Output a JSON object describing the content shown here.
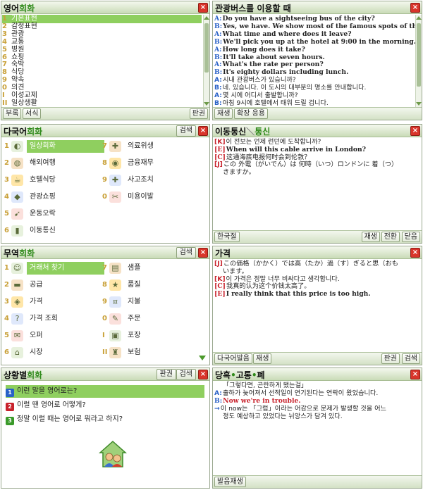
{
  "colors": {
    "accent_green": "#8fcf5f",
    "title_green": "#2f8a1a",
    "number_gold": "#c8a037",
    "speaker_red": "#c8222c",
    "speaker_blue": "#2a62c7"
  },
  "p1": {
    "title_a": "영어",
    "title_b": "회화",
    "items": [
      {
        "num": "1",
        "label": "기본표현"
      },
      {
        "num": "2",
        "label": "감정표현"
      },
      {
        "num": "3",
        "label": "관광"
      },
      {
        "num": "4",
        "label": "교통"
      },
      {
        "num": "5",
        "label": "병원"
      },
      {
        "num": "6",
        "label": "쇼핑"
      },
      {
        "num": "7",
        "label": "숙박"
      },
      {
        "num": "8",
        "label": "식당"
      },
      {
        "num": "9",
        "label": "약속"
      },
      {
        "num": "0",
        "label": "의견"
      },
      {
        "num": "I",
        "label": "이성교제"
      },
      {
        "num": "II",
        "label": "일상생활"
      }
    ],
    "btn_appendix": "부록",
    "btn_format": "서식",
    "btn_switch": "판권"
  },
  "p2": {
    "title": "관광버스를 이용할 때",
    "lines": [
      {
        "p": "A:",
        "t": "Do you have a sightseeing bus of the city?"
      },
      {
        "p": "B:",
        "t": "Yes, we have. We show most of the famous spots of this city."
      },
      {
        "p": "A:",
        "t": "What time and where does it leave?"
      },
      {
        "p": "B:",
        "t": "We'll pick you up at the hotel at 9:00 in the morning."
      },
      {
        "p": "A:",
        "t": "How long does it take?"
      },
      {
        "p": "B:",
        "t": "It'll take about seven hours."
      },
      {
        "p": "A:",
        "t": "What's the rate per person?"
      },
      {
        "p": "B:",
        "t": "It's eighty dollars including lunch."
      },
      {
        "p": "A:",
        "t": "시내 관광버스가 있습니까?"
      },
      {
        "p": "B:",
        "t": "네. 있습니다. 이 도시의 대부분의 명소를 안내합니다."
      },
      {
        "p": "A:",
        "t": "몇 시에 어디서 출발합니까?"
      },
      {
        "p": "B:",
        "t": "아침 9시에 호텔에서 태워 드릴 겁니다."
      }
    ],
    "btn_play": "재생",
    "btn_expand": "확장 응용"
  },
  "p3": {
    "title_a": "다국어",
    "title_b": "회화",
    "btn_search": "검색",
    "items": [
      {
        "num": "1",
        "label": "일상회화",
        "icon": "ear-icon"
      },
      {
        "num": "2",
        "label": "해외여행",
        "icon": "globe-icon"
      },
      {
        "num": "3",
        "label": "호텔식당",
        "icon": "cup-icon"
      },
      {
        "num": "4",
        "label": "관광쇼핑",
        "icon": "bag-icon"
      },
      {
        "num": "5",
        "label": "운동오락",
        "icon": "runner-icon"
      },
      {
        "num": "6",
        "label": "이동통신",
        "icon": "phone-icon"
      },
      {
        "num": "7",
        "label": "의료위생",
        "icon": "medical-icon"
      },
      {
        "num": "8",
        "label": "금융재무",
        "icon": "money-icon"
      },
      {
        "num": "9",
        "label": "사고조치",
        "icon": "firstaid-icon"
      },
      {
        "num": "0",
        "label": "미용이발",
        "icon": "barber-icon"
      }
    ]
  },
  "p4": {
    "title_a": "이동통신",
    "title_b": "통신",
    "lines": [
      {
        "p": "[K]",
        "t": "이 전보는 언제 런던에 도착합니까?"
      },
      {
        "p": "[E]",
        "t": "When will this cable arrive in London?"
      },
      {
        "p": "[C]",
        "t": "这通海底电报何时会到伦敦？"
      },
      {
        "p": "[J]",
        "t": "この 外電（がいでん）は 何時（いつ）ロンドンに 着（つ）"
      },
      {
        "p": "",
        "t": "きますか。"
      }
    ],
    "btn_korean": "한국절",
    "btn_play": "재생",
    "btn_switch": "전환",
    "btn_close": "닫음"
  },
  "p5": {
    "title_a": "무역",
    "title_b": "회화",
    "btn_search": "검색",
    "items": [
      {
        "num": "1",
        "label": "거래처 찾기",
        "icon": "search-person-icon"
      },
      {
        "num": "2",
        "label": "공급",
        "icon": "truck-icon"
      },
      {
        "num": "3",
        "label": "가격",
        "icon": "tag-icon"
      },
      {
        "num": "4",
        "label": "가격 조회",
        "icon": "price-query-icon"
      },
      {
        "num": "5",
        "label": "오퍼",
        "icon": "offer-icon"
      },
      {
        "num": "6",
        "label": "시장",
        "icon": "market-icon"
      },
      {
        "num": "7",
        "label": "샘플",
        "icon": "sample-icon"
      },
      {
        "num": "8",
        "label": "품질",
        "icon": "quality-icon"
      },
      {
        "num": "9",
        "label": "지불",
        "icon": "payment-icon"
      },
      {
        "num": "0",
        "label": "주문",
        "icon": "order-icon"
      },
      {
        "num": "I",
        "label": "포장",
        "icon": "package-icon"
      },
      {
        "num": "II",
        "label": "보험",
        "icon": "insurance-icon"
      }
    ]
  },
  "p6": {
    "title": "가격",
    "lines": [
      {
        "p": "[J]",
        "t": "この価格（かかく）では高（たか）過（す）ぎると思（おも"
      },
      {
        "p": "",
        "t": "います。"
      },
      {
        "p": "[K]",
        "t": "이 가격은 정말 너무 비싸다고 생각합니다."
      },
      {
        "p": "[C]",
        "t": "我真的认为这个价钱太高了。"
      },
      {
        "p": "[E]",
        "t": "I really think that this price is too high."
      }
    ],
    "btn_multi": "다국어발음",
    "btn_play": "재생",
    "btn_switch": "판권",
    "btn_search": "검색"
  },
  "p7": {
    "title_a": "상황별",
    "title_b": "회화",
    "btn_switch": "판권",
    "btn_search": "검색",
    "items": [
      {
        "label": "이런 말을 영어로는?",
        "color": "#2a62c7",
        "mark": "1"
      },
      {
        "label": "이럴 땐 영어로 어떻게?",
        "color": "#c8222c",
        "mark": "2"
      },
      {
        "label": "정말 이럴 때는 영어로 뭐라고 하지?",
        "color": "#3a9a2a",
        "mark": "3"
      }
    ]
  },
  "p8": {
    "title_a": "당혹",
    "title_b": "고통",
    "title_c": "폐",
    "lines": [
      {
        "p": "",
        "t": "「그렇다면, 곤란하게 됐는걸」"
      },
      {
        "p": "A:",
        "t": "출하가 늦어져서 선적일이 연기된다는 연락이 왔었습니다."
      },
      {
        "p": "B:",
        "t": "Now we're in trouble."
      },
      {
        "p": "→",
        "t": "이 now는 「그럼」이라는 어감으로 문제가 발생할 것을 어느"
      },
      {
        "p": "",
        "t": "정도 예상하고 있었다는 뉘앙스가 담겨 있다."
      }
    ],
    "btn_play": "발음재생"
  }
}
